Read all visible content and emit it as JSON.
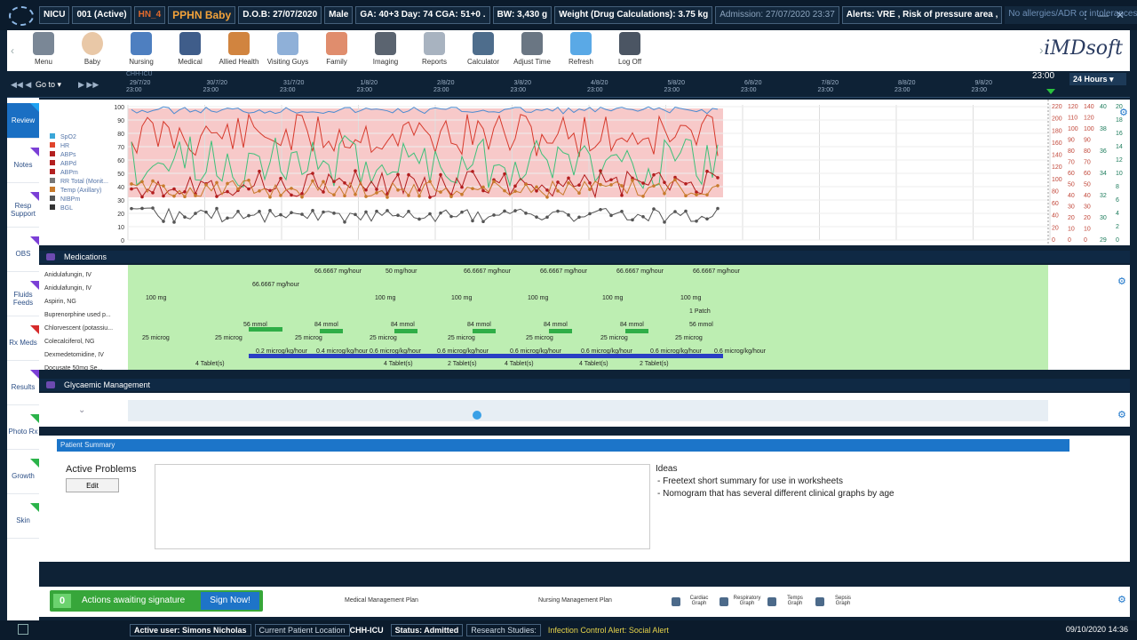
{
  "topbar": {
    "unit": "NICU",
    "bed": "001 (Active)",
    "hn": "HN_4",
    "patient": "PPHN Baby",
    "dob": "D.O.B: 27/07/2020",
    "sex": "Male",
    "ga": "GA: 40+3 Day: 74 CGA: 51+0 .",
    "bw": "BW: 3,430 g",
    "weight": "Weight (Drug Calculations): 3.75 kg",
    "admission": "Admission: 27/07/2020 23:37",
    "alerts": "Alerts: VRE , Risk of pressure area ,",
    "allergies": "No allergies/ADR or intolerances repor..."
  },
  "toolbar": {
    "items": [
      {
        "label": "Menu",
        "icon": "menu-icon"
      },
      {
        "label": "Baby",
        "icon": "baby-icon"
      },
      {
        "label": "Nursing",
        "icon": "nurse-icon"
      },
      {
        "label": "Medical",
        "icon": "doctor-icon"
      },
      {
        "label": "Allied Health",
        "icon": "allied-health-icon"
      },
      {
        "label": "Visiting Guys",
        "icon": "visitor-icon"
      },
      {
        "label": "Family",
        "icon": "family-icon"
      },
      {
        "label": "Imaging",
        "icon": "xray-icon"
      },
      {
        "label": "Reports",
        "icon": "reports-icon"
      },
      {
        "label": "Calculator",
        "icon": "calculator-icon"
      },
      {
        "label": "Adjust Time",
        "icon": "clock-icon"
      },
      {
        "label": "Refresh",
        "icon": "refresh-icon"
      },
      {
        "label": "Log Off",
        "icon": "logoff-icon"
      }
    ],
    "brand": "iMDsoft"
  },
  "timeline": {
    "goto": "Go to",
    "unit_label": "CHH-ICU",
    "current_time": "23:00",
    "range": "24 Hours",
    "dates": [
      "29/7/20",
      "30/7/20",
      "31/7/20",
      "1/8/20",
      "2/8/20",
      "3/8/20",
      "4/8/20",
      "5/8/20",
      "6/8/20",
      "7/8/20",
      "8/8/20",
      "9/8/20"
    ],
    "time_label": "23:00"
  },
  "sidenav": [
    {
      "label": "Review",
      "active": true,
      "flag": "#1da1f2"
    },
    {
      "label": "Notes",
      "active": false,
      "flag": "#7b3fd6"
    },
    {
      "label": "Resp Support",
      "active": false,
      "flag": "#7b3fd6"
    },
    {
      "label": "OBS",
      "active": false,
      "flag": "#7b3fd6"
    },
    {
      "label": "Fluids Feeds",
      "active": false,
      "flag": "#7b3fd6"
    },
    {
      "label": "Rx Meds",
      "active": false,
      "flag": "#d62b2b"
    },
    {
      "label": "Results",
      "active": false,
      "flag": "#7b3fd6"
    },
    {
      "label": "Photo Rx",
      "active": false,
      "flag": "#2bb34a"
    },
    {
      "label": "Growth",
      "active": false,
      "flag": "#2bb34a"
    },
    {
      "label": "Skin",
      "active": false,
      "flag": "#2bb34a"
    }
  ],
  "vitals": {
    "legend": [
      "SpO2",
      "HR",
      "ABPs",
      "ABPd",
      "ABPm",
      "RR Total (Monit...",
      "Temp (Axillary)",
      "NIBPm",
      "BGL"
    ],
    "yticks": [
      "100",
      "90",
      "80",
      "70",
      "60",
      "50",
      "40",
      "30",
      "20",
      "10",
      "0"
    ],
    "right_axis_a": [
      "220",
      "200",
      "180",
      "160",
      "140",
      "120",
      "100",
      "80",
      "60",
      "40",
      "20",
      "0"
    ],
    "right_axis_b": [
      "120",
      "110",
      "100",
      "90",
      "80",
      "70",
      "60",
      "50",
      "40",
      "30",
      "20",
      "10",
      "0"
    ],
    "right_axis_c": [
      "140",
      "120",
      "100",
      "90",
      "80",
      "70",
      "60",
      "50",
      "40",
      "30",
      "20",
      "10",
      "0"
    ],
    "right_axis_d": [
      "40",
      "38",
      "36",
      "34",
      "32",
      "30",
      "29"
    ],
    "right_axis_e": [
      "20",
      "18",
      "16",
      "14",
      "12",
      "10",
      "8",
      "6",
      "4",
      "2",
      "0"
    ]
  },
  "medications": {
    "title": "Medications",
    "rows": [
      "Anidulafungin, IV",
      "Anidulafungin, IV",
      "Aspirin, NG",
      "Buprenorphine used p...",
      "Chlorvescent (potassiu...",
      "Colecalciferol, NG",
      "Dexmedetomidine, IV",
      "Docusate 50mg Se..."
    ],
    "doses": {
      "anidula_a": "66.6667 mg/hour",
      "anidula_b": "50 mg/hour",
      "anidula_c": "66.6667 mg/hour",
      "aspirin": "100 mg",
      "patch": "1 Patch",
      "chlor_a": "56 mmol",
      "chlor_b": "84 mmol",
      "col": "25 microg",
      "dex_a": "0.2 microg/kg/hour",
      "dex_b": "0.4 microg/kg/hour",
      "dex_c": "0.6 microg/kg/hour",
      "doc_a": "4 Tablet(s)",
      "doc_b": "2 Tablet(s)"
    }
  },
  "glycaemic": {
    "title": "Glycaemic Management"
  },
  "summary": {
    "header": "Patient Summary",
    "active_problems": "Active Problems",
    "edit": "Edit",
    "ideas_title": "Ideas",
    "ideas": [
      "- Freetext short summary for use in worksheets",
      "- Nomogram that has several different clinical graphs by age"
    ]
  },
  "footer": {
    "actions_count": "0",
    "actions_label": "Actions awaiting signature",
    "sign_now": "Sign Now!",
    "medical_plan": "Medical Management Plan",
    "nursing_plan": "Nursing Management Plan",
    "graphs": [
      {
        "label": "Cardiac Graph"
      },
      {
        "label": "Respiratory Graph"
      },
      {
        "label": "Temps Graph"
      },
      {
        "label": "Sepsis Graph"
      }
    ]
  },
  "statusbar": {
    "user": "Active user: Simons Nicholas",
    "location_label": "Current Patient Location",
    "location": "CHH-ICU",
    "status": "Status: Admitted",
    "research": "Research Studies:",
    "infection": "Infection Control Alert: Social Alert",
    "datetime": "09/10/2020 14:36"
  },
  "colors": {
    "accent": "#1c75c9",
    "topbar": "#0b1b2c",
    "med_bg": "#b9efb0",
    "vital_band": "#f7c9c9"
  }
}
